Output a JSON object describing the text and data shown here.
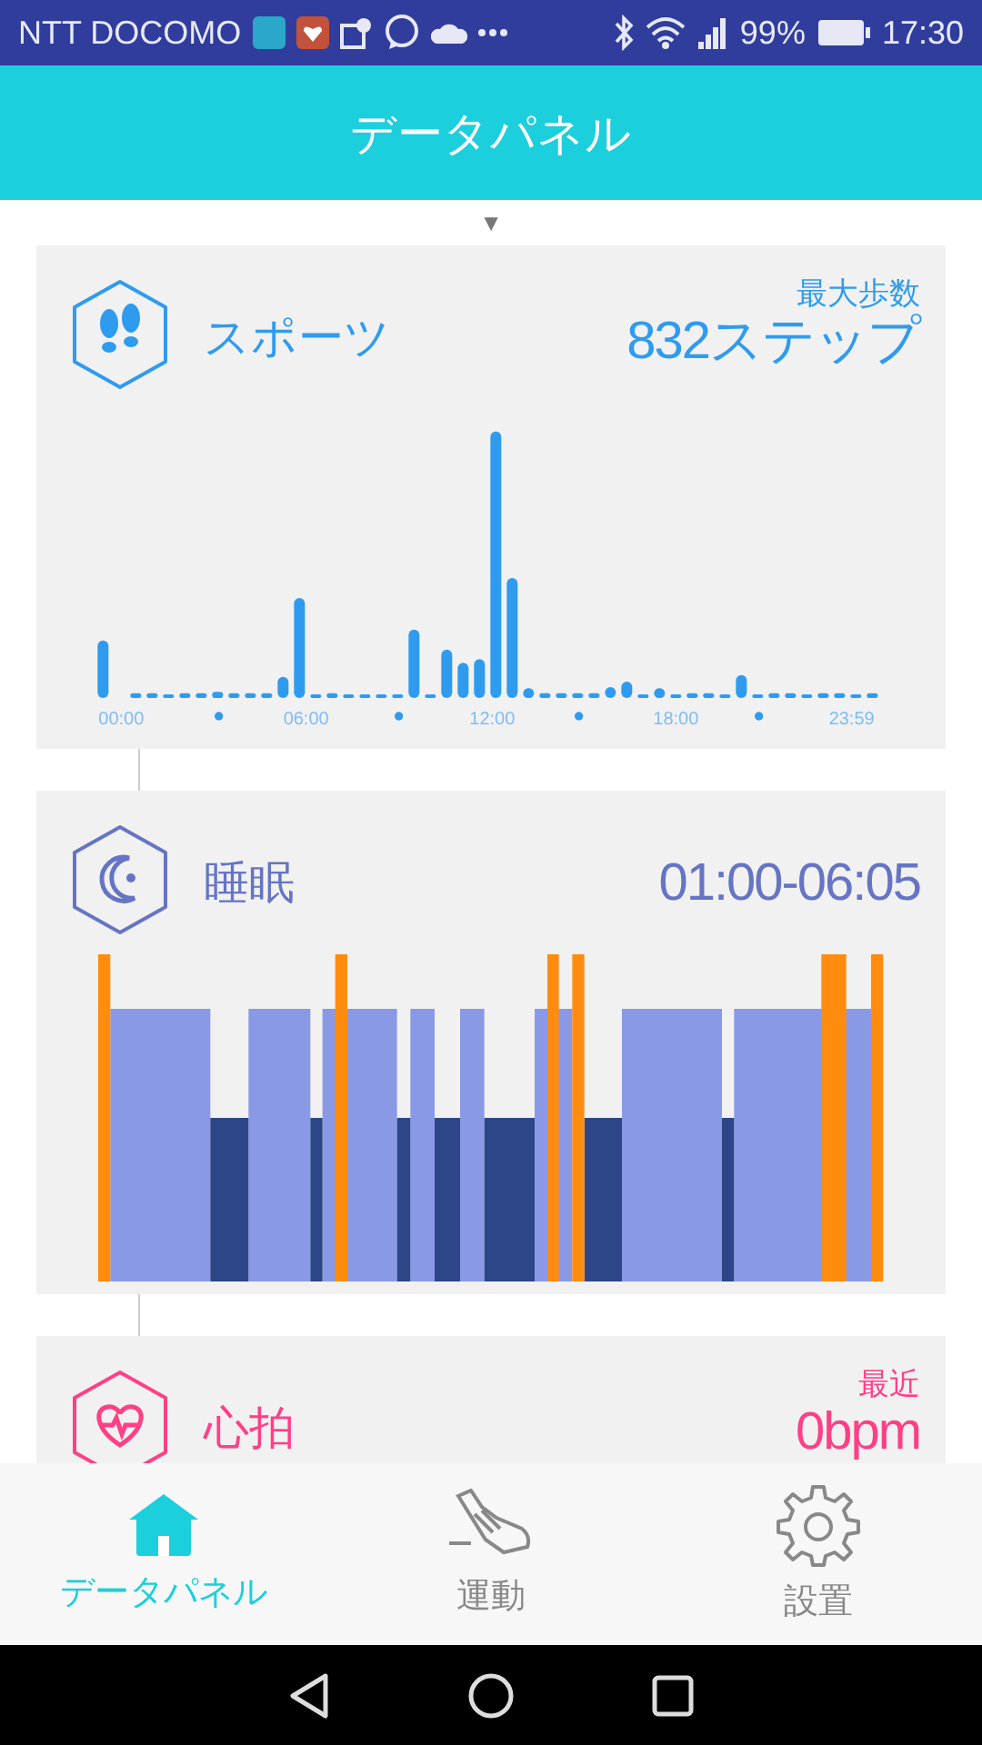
{
  "status_bar": {
    "carrier": "NTT DOCOMO",
    "battery": "99%",
    "time": "17:30"
  },
  "header": {
    "title": "データパネル"
  },
  "expand_marker": "▼",
  "cards": [
    {
      "kind": "steps",
      "title": "スポーツ",
      "label": "最大歩数",
      "value": "832ステップ",
      "color": "#2f9bef",
      "axis_labels": [
        "00:00",
        "06:00",
        "12:00",
        "18:00",
        "23:59"
      ]
    },
    {
      "kind": "sleep",
      "title": "睡眠",
      "value": "01:00-06:05",
      "color": "#6674c4"
    },
    {
      "kind": "heart",
      "title": "心拍",
      "label": "最近",
      "value": "0bpm",
      "color": "#ff3f86"
    }
  ],
  "tabs": [
    {
      "kind": "home",
      "label": "データパネル",
      "selected": true
    },
    {
      "kind": "shoe",
      "label": "運動",
      "selected": false
    },
    {
      "kind": "gear",
      "label": "設置",
      "selected": false
    }
  ]
}
